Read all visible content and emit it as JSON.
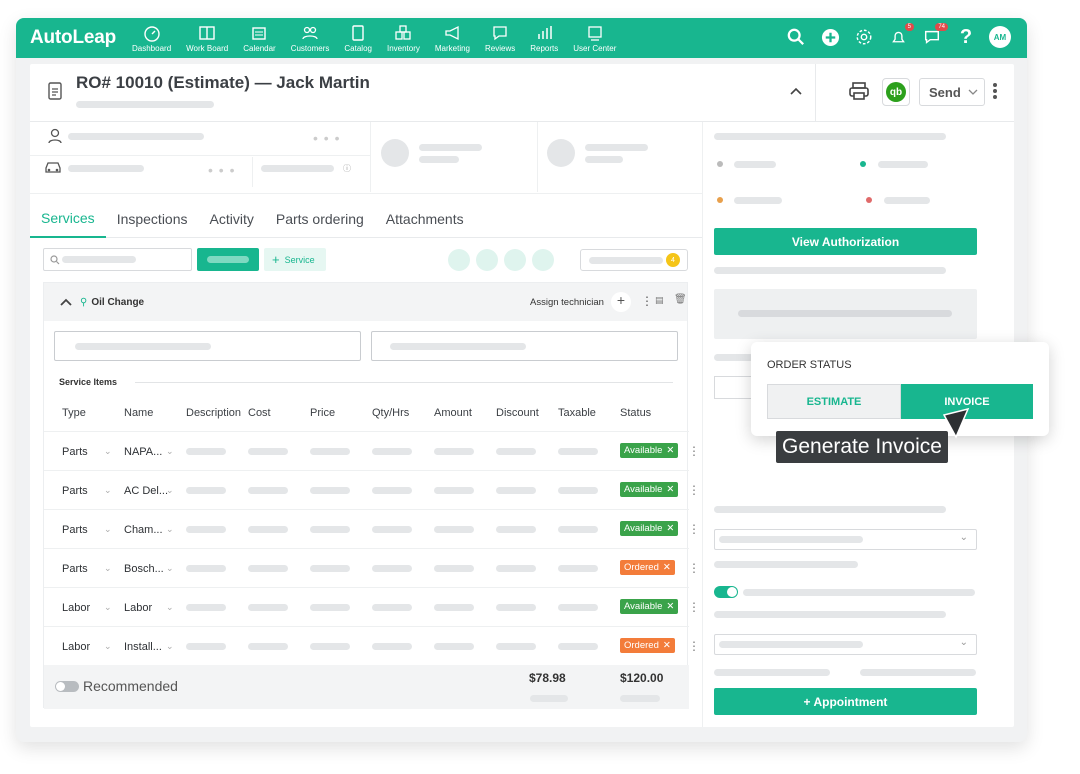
{
  "app": {
    "logo": "AutoLeap"
  },
  "nav": [
    {
      "label": "Dashboard",
      "icon": "dashboard-icon"
    },
    {
      "label": "Work Board",
      "icon": "workboard-icon"
    },
    {
      "label": "Calendar",
      "icon": "calendar-icon"
    },
    {
      "label": "Customers",
      "icon": "customers-icon"
    },
    {
      "label": "Catalog",
      "icon": "catalog-icon"
    },
    {
      "label": "Inventory",
      "icon": "inventory-icon"
    },
    {
      "label": "Marketing",
      "icon": "marketing-icon"
    },
    {
      "label": "Reviews",
      "icon": "reviews-icon"
    },
    {
      "label": "Reports",
      "icon": "reports-icon"
    },
    {
      "label": "User Center",
      "icon": "user-center-icon"
    }
  ],
  "topbar": {
    "notif_count": "5",
    "chat_count": "74",
    "avatar": "AM"
  },
  "header": {
    "title": "RO# 10010 (Estimate) — Jack Martin",
    "send_label": "Send",
    "qb_label": "qb"
  },
  "tabs": [
    "Services",
    "Inspections",
    "Activity",
    "Parts ordering",
    "Attachments"
  ],
  "toolbar": {
    "add_service": "Service",
    "count_badge": "4"
  },
  "service": {
    "name": "Oil Change",
    "assign": "Assign technician",
    "items_label": "Service Items"
  },
  "columns": [
    "Type",
    "Name",
    "Description",
    "Cost",
    "Price",
    "Qty/Hrs",
    "Amount",
    "Discount",
    "Taxable",
    "Status"
  ],
  "rows": [
    {
      "type": "Parts",
      "name": "NAPA...",
      "status": "Available"
    },
    {
      "type": "Parts",
      "name": "AC Del...",
      "status": "Available"
    },
    {
      "type": "Parts",
      "name": "Cham...",
      "status": "Available"
    },
    {
      "type": "Parts",
      "name": "Bosch...",
      "status": "Ordered"
    },
    {
      "type": "Labor",
      "name": "Labor",
      "status": "Available"
    },
    {
      "type": "Labor",
      "name": "Install...",
      "status": "Ordered"
    }
  ],
  "totals": {
    "amount": "$78.98",
    "total": "$120.00",
    "recommended": "Recommended"
  },
  "right": {
    "view_auth": "View Authorization",
    "appointment": "+ Appointment"
  },
  "order_status": {
    "title": "ORDER STATUS",
    "estimate": "ESTIMATE",
    "invoice": "INVOICE",
    "tooltip": "Generate Invoice"
  },
  "colors": {
    "brand": "#18b68f",
    "available": "#3aa34a",
    "ordered": "#f37c3a"
  }
}
